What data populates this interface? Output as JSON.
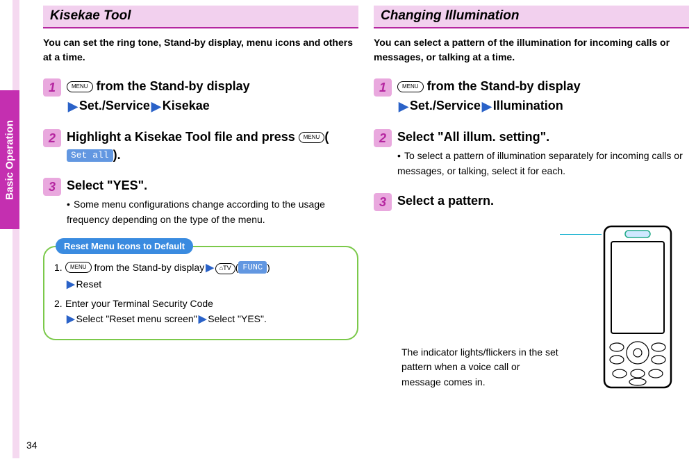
{
  "page_number": "34",
  "side_tab": "Basic Operation",
  "left": {
    "title": "Kisekae Tool",
    "intro": "You can set the ring tone, Stand-by display, menu icons and others at a time.",
    "step1_a": " from the Stand-by display",
    "step1_path1": "Set./Service",
    "step1_path2": "Kisekae",
    "step2_a": "Highlight a Kisekae Tool file and press ",
    "step2_chip": "Set all",
    "step2_close": ").",
    "step3_title": "Select \"YES\".",
    "step3_sub": "Some menu configurations change according to the usage frequency depending on the type of the menu.",
    "reset_title": "Reset Menu Icons to Default",
    "reset_item1_a": " from the Stand-by display",
    "reset_func": "FUNC",
    "reset_item1_b": "Reset",
    "reset_item2_a": "Enter your Terminal Security Code",
    "reset_item2_b": "Select \"Reset menu screen\"",
    "reset_item2_c": "Select \"YES\"."
  },
  "right": {
    "title": "Changing Illumination",
    "intro": "You can select a pattern of the illumination for incoming calls or messages, or talking at a time.",
    "step1_a": " from the Stand-by display",
    "step1_path1": "Set./Service",
    "step1_path2": "Illumination",
    "step2_title": "Select \"All illum. setting\".",
    "step2_sub": "To select a pattern of illumination separately for incoming calls or messages, or talking, select it for each.",
    "step3_title": "Select a pattern.",
    "phone_note": "The indicator lights/flickers in the set pattern when a voice call or message comes in."
  },
  "keys": {
    "menu": "MENU",
    "cam": "⌂TV"
  }
}
